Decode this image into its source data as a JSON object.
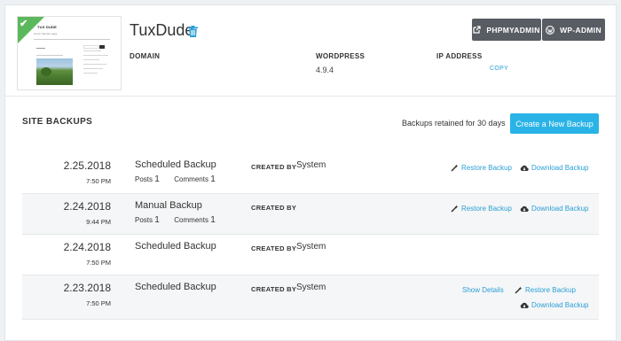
{
  "site": {
    "name": "TuxDude",
    "thumbnail": {
      "title": "TUX DUDE",
      "nav": "Home   Sample page"
    },
    "domain_label": "DOMAIN",
    "domain_value": "",
    "wordpress_label": "WORDPRESS",
    "wordpress_version": "4.9.4",
    "ip_label": "IP ADDRESS",
    "ip_value": "",
    "copy_label": "COPY",
    "buttons": {
      "phpmyadmin": "PHPMYADMIN",
      "wp_admin": "WP-ADMIN"
    }
  },
  "backups": {
    "title": "SITE BACKUPS",
    "retention_text": "Backups retained for 30 days",
    "create_button": "Create a New Backup",
    "created_by_label": "CREATED BY",
    "posts_label": "Posts",
    "comments_label": "Comments",
    "restore_label": "Restore Backup",
    "download_label": "Download Backup",
    "details_label": "Show Details",
    "rows": [
      {
        "date": "2.25.2018",
        "time": "7:50 PM",
        "type": "Scheduled Backup",
        "posts": "1",
        "comments": "1",
        "user": "System"
      },
      {
        "date": "2.24.2018",
        "time": "9:44 PM",
        "type": "Manual Backup",
        "posts": "1",
        "comments": "1",
        "user": ""
      },
      {
        "date": "2.24.2018",
        "time": "7:50 PM",
        "type": "Scheduled Backup",
        "user": "System"
      },
      {
        "date": "2.23.2018",
        "time": "7:50 PM",
        "type": "Scheduled Backup",
        "user": "System"
      }
    ]
  },
  "colors": {
    "accent": "#29b3e6",
    "link": "#2a9fd6",
    "dark_button": "#585c63",
    "success": "#5cb85c"
  }
}
